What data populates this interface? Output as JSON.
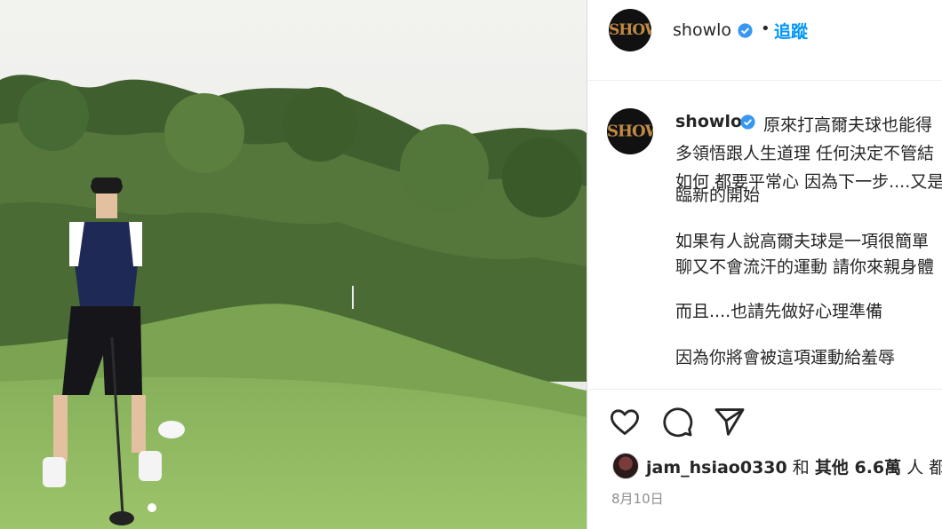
{
  "post": {
    "author": "showlo",
    "avatar_text": "SHOW",
    "follow_label": "追蹤",
    "separator": "•",
    "caption_lines": [
      "原來打高爾夫球也能得",
      "多領悟跟人生道理 任何決定不管結",
      "如何 都要平常心 因為下一步....又是",
      "臨新的開始",
      "如果有人說高爾夫球是一項很簡單",
      "聊又不會流汗的運動 請你來親身體",
      "而且....也請先做好心理準備",
      "因為你將會被這項運動給羞辱"
    ],
    "liked_by_user": "jam_hsiao0330",
    "liked_by_connector": "和",
    "liked_by_others": "其他 6.6萬",
    "liked_by_suffix": "人 都說",
    "date": "8月10日"
  },
  "icons": {
    "verified": "verified-badge-icon",
    "like": "heart-icon",
    "comment": "comment-icon",
    "share": "send-icon"
  },
  "colors": {
    "link": "#0095f6",
    "verified": "#3897f0",
    "text": "#262626",
    "muted": "#8e8e8e",
    "border": "#dbdbdb"
  }
}
